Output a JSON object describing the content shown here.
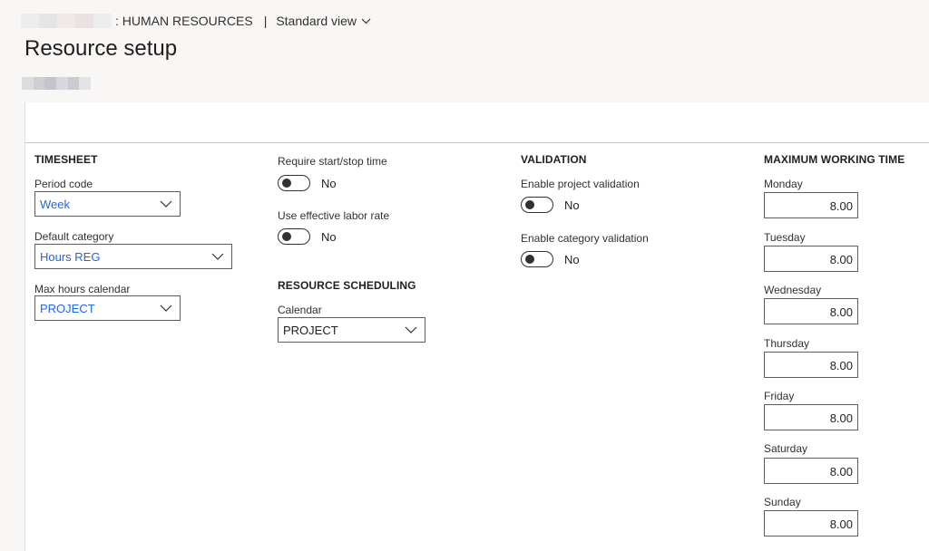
{
  "header": {
    "module": ": HUMAN RESOURCES",
    "separator": "|",
    "view": "Standard view",
    "title": "Resource setup"
  },
  "timesheet": {
    "title": "TIMESHEET",
    "period_code": {
      "label": "Period code",
      "value": "Week"
    },
    "default_category": {
      "label": "Default category",
      "value": "Hours REG"
    },
    "max_hours_calendar": {
      "label": "Max hours calendar",
      "value": "PROJECT"
    }
  },
  "options": {
    "require_start_stop": {
      "label": "Require start/stop time",
      "state": "No"
    },
    "effective_labor_rate": {
      "label": "Use effective labor rate",
      "state": "No"
    }
  },
  "scheduling": {
    "title": "RESOURCE SCHEDULING",
    "calendar": {
      "label": "Calendar",
      "value": "PROJECT"
    }
  },
  "validation": {
    "title": "VALIDATION",
    "project": {
      "label": "Enable project validation",
      "state": "No"
    },
    "category": {
      "label": "Enable category validation",
      "state": "No"
    }
  },
  "max_working_time": {
    "title": "MAXIMUM WORKING TIME",
    "days": [
      {
        "label": "Monday",
        "value": "8.00"
      },
      {
        "label": "Tuesday",
        "value": "8.00"
      },
      {
        "label": "Wednesday",
        "value": "8.00"
      },
      {
        "label": "Thursday",
        "value": "8.00"
      },
      {
        "label": "Friday",
        "value": "8.00"
      },
      {
        "label": "Saturday",
        "value": "8.00"
      },
      {
        "label": "Sunday",
        "value": "8.00"
      }
    ]
  },
  "colors": {
    "accent_blue": "#2266e3",
    "background": "#f8f7f6",
    "border": "#605e5c"
  }
}
